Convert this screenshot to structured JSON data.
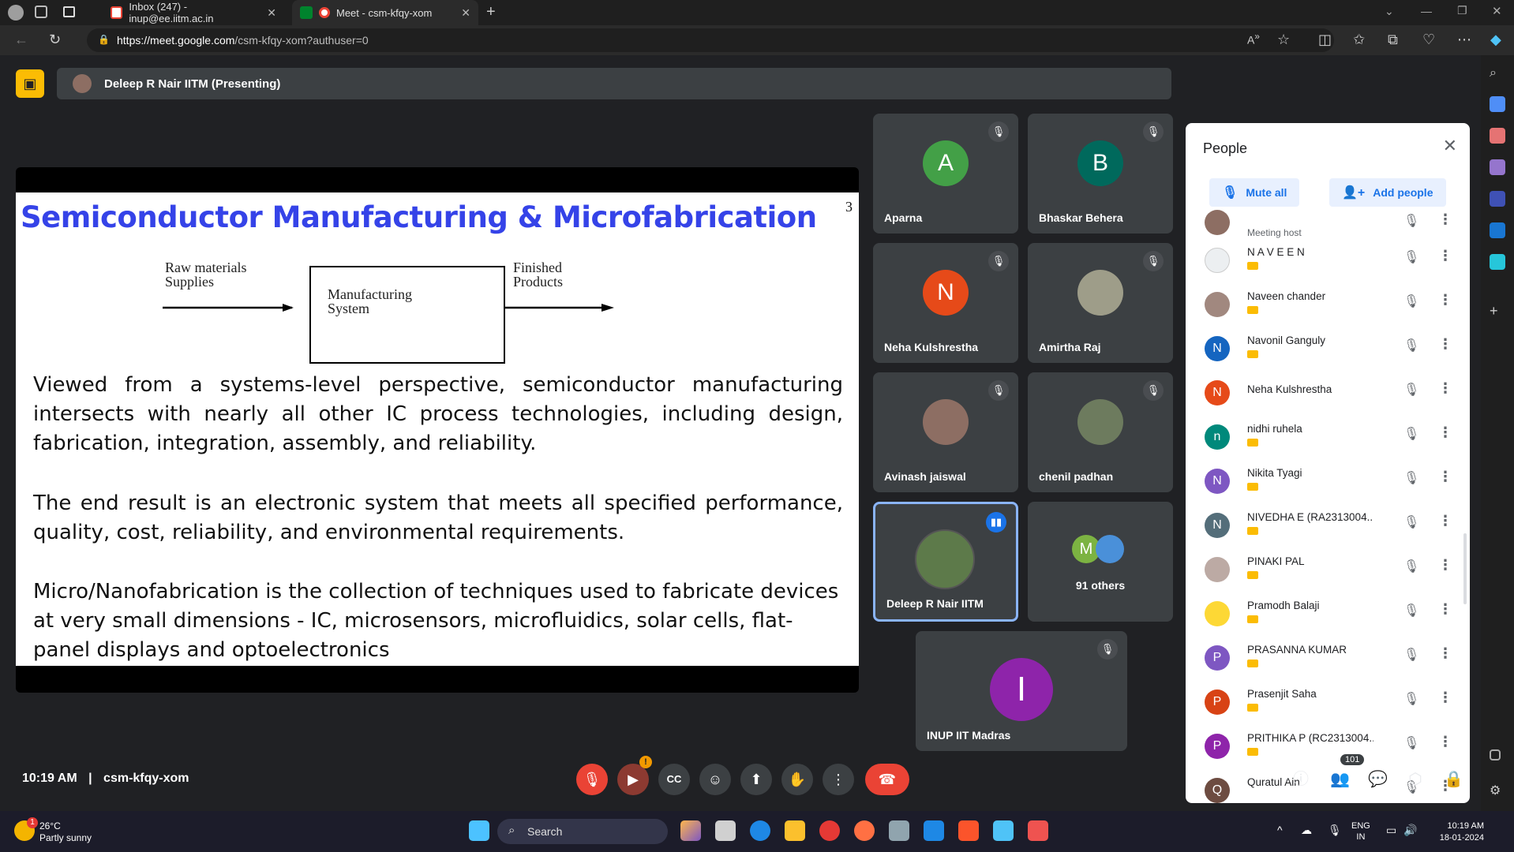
{
  "browser": {
    "tabs": [
      {
        "label": "Inbox (247) - inup@ee.iitm.ac.in",
        "favicon": "gmail-icon"
      },
      {
        "label": "Meet - csm-kfqy-xom",
        "favicon": "meet-icon"
      }
    ],
    "url_host": "https://meet.google.com",
    "url_path": "/csm-kfqy-xom?authuser=0"
  },
  "presenting": {
    "label": "Deleep R Nair IITM (Presenting)"
  },
  "slide": {
    "title": "Semiconductor Manufacturing & Microfabrication",
    "page_number": "3",
    "diagram": {
      "input_label_1": "Raw materials",
      "input_label_2": "Supplies",
      "box_label_1": "Manufacturing",
      "box_label_2": "System",
      "output_label_1": "Finished",
      "output_label_2": "Products"
    },
    "paragraphs": [
      "Viewed from a systems-level perspective, semiconductor manufacturing intersects with nearly all other IC process technologies, including design, fabrication, integration, assembly, and reliability.",
      "The end result is an electronic system that meets all specified performance, quality, cost, reliability, and environmental requirements.",
      "Micro/Nanofabrication is the collection of techniques used to fabricate devices at very small dimensions - IC, microsensors, microfluidics, solar cells, flat-panel displays and optoelectronics"
    ]
  },
  "tiles": [
    {
      "name": "Aparna",
      "initial": "A",
      "color": "#43a047"
    },
    {
      "name": "Bhaskar Behera",
      "initial": "B",
      "color": "#00695c"
    },
    {
      "name": "Neha Kulshrestha",
      "initial": "N",
      "color": "#e64a19"
    },
    {
      "name": "Amirtha Raj",
      "initial": "",
      "color": "#9e9d89"
    },
    {
      "name": "Avinash jaiswal",
      "initial": "",
      "color": "#8d6e63"
    },
    {
      "name": "chenil padhan",
      "initial": "",
      "color": "#6d7b5e"
    },
    {
      "name": "Deleep R Nair IITM",
      "initial": "",
      "color": "#5d7a4a"
    },
    {
      "name": "91 others",
      "initial": "M",
      "color": "#7cb342"
    },
    {
      "name": "INUP IIT Madras",
      "initial": "I",
      "color": "#8e24aa"
    }
  ],
  "footer": {
    "time": "10:19 AM",
    "separator": "|",
    "meeting_code": "csm-kfqy-xom",
    "participant_count": "101",
    "notification_badge": "!"
  },
  "people_panel": {
    "title": "People",
    "mute_all": "Mute all",
    "add_people": "Add people",
    "host_label": "Meeting host",
    "participants": [
      {
        "name": "N A V E E N",
        "initial": "",
        "color": "#eceff1"
      },
      {
        "name": "Naveen chander",
        "initial": "",
        "color": "#a1887f"
      },
      {
        "name": "Navonil Ganguly",
        "initial": "N",
        "color": "#1565c0"
      },
      {
        "name": "Neha Kulshrestha",
        "initial": "N",
        "color": "#e64a19"
      },
      {
        "name": "nidhi ruhela",
        "initial": "n",
        "color": "#00897b"
      },
      {
        "name": "Nikita Tyagi",
        "initial": "N",
        "color": "#7e57c2"
      },
      {
        "name": "NIVEDHA E (RA2313004...",
        "initial": "N",
        "color": "#546e7a"
      },
      {
        "name": "PINAKI PAL",
        "initial": "",
        "color": "#bcaaa4"
      },
      {
        "name": "Pramodh Balaji",
        "initial": "",
        "color": "#fdd835"
      },
      {
        "name": "PRASANNA KUMAR",
        "initial": "P",
        "color": "#7e57c2"
      },
      {
        "name": "Prasenjit Saha",
        "initial": "P",
        "color": "#d84315"
      },
      {
        "name": "PRITHIKA P (RC2313004...",
        "initial": "P",
        "color": "#8e24aa"
      },
      {
        "name": "Quratul Ain",
        "initial": "Q",
        "color": "#6d4c41"
      }
    ]
  },
  "taskbar": {
    "temperature": "26°C",
    "weather": "Partly sunny",
    "weather_badge": "1",
    "search_label": "Search",
    "lang_1": "ENG",
    "lang_2": "IN",
    "clock_time": "10:19 AM",
    "clock_date": "18-01-2024"
  }
}
